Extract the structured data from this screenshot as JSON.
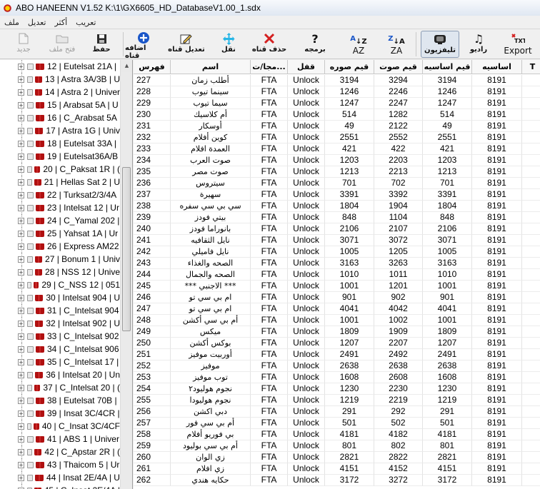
{
  "window": {
    "title": "ABO HANEENN    V1.52 K:\\1\\GX6605_HD_DatabaseV1.00_1.sdx"
  },
  "menu": [
    "ملف",
    "تعديل",
    "أكثر",
    "تعريب"
  ],
  "toolbar": {
    "new": "جديد",
    "open": "فتح ملف",
    "save": "حفظ",
    "add_channel": "اضافه قناه",
    "edit_channel": "تعديل قناه",
    "move": "نقل",
    "delete": "حذف قناه",
    "program": "برمجه",
    "sort_az": "AZ",
    "sort_za": "ZA",
    "tv": "تليفزيون",
    "radio": "راديو",
    "export": "Export"
  },
  "tree": {
    "items": [
      "12 | Eutelsat 21A |",
      "13 | Astra 3A/3B | U",
      "14 | Astra 2 | Univer",
      "15 | Arabsat 5A | U",
      "16 | C_Arabsat 5A",
      "17 | Astra 1G | Univ",
      "18 | Eutelsat 33A |",
      "19 | Eutelsat36A/B",
      "20 | C_Paksat 1R | (",
      "21 | Hellas Sat 2 | U",
      "22 | Turksat2/3/4A",
      "23 | Intelsat 12 | Ur",
      "24 | C_Yamal 202 |",
      "25 | Yahsat 1A | Ur",
      "26 | Express AM22",
      "27 | Bonum 1 | Univ",
      "28 | NSS 12 | Unive",
      "29 | C_NSS 12 | 051",
      "30 | Intelsat 904 | U",
      "31 | C_Intelsat 904",
      "32 | Intelsat 902 | U",
      "33 | C_Intelsat 902",
      "34 | C_Intelsat 906",
      "35 | C_Intelsat 17 |",
      "36 | Intelsat 20 | Un",
      "37 | C_Intelsat 20 | (",
      "38 | Eutelsat 70B |",
      "39 | Insat 3C/4CR |",
      "40 | C_Insat 3C/4CF",
      "41 | ABS 1 | Univer",
      "42 | C_Apstar 2R | (",
      "43 | Thaicom 5 | Ur",
      "44 | Insat 2E/4A | U",
      "45 | C_Insat 2E/4A |"
    ]
  },
  "grid": {
    "headers": [
      "فهرس",
      "اسم",
      "مجا/ت...",
      "قفل",
      "قيم صوره",
      "قيم صوت",
      "قيم اساسيه",
      "اساسيه",
      "T"
    ],
    "rows": [
      [
        "227",
        "أطلب زمان",
        "FTA",
        "Unlock",
        "3194",
        "3294",
        "3194",
        "8191"
      ],
      [
        "228",
        "سينما تيوب",
        "FTA",
        "Unlock",
        "1246",
        "2246",
        "1246",
        "8191"
      ],
      [
        "229",
        "سيما تيوب",
        "FTA",
        "Unlock",
        "1247",
        "2247",
        "1247",
        "8191"
      ],
      [
        "230",
        "أم كلاسيك",
        "FTA",
        "Unlock",
        "514",
        "1282",
        "514",
        "8191"
      ],
      [
        "231",
        "أوسكار",
        "FTA",
        "Unlock",
        "49",
        "2122",
        "49",
        "8191"
      ],
      [
        "232",
        "كوين أفلام",
        "FTA",
        "Unlock",
        "2551",
        "2552",
        "2551",
        "8191"
      ],
      [
        "233",
        "العمدة افلام",
        "FTA",
        "Unlock",
        "421",
        "422",
        "421",
        "8191"
      ],
      [
        "234",
        "صوت العرب",
        "FTA",
        "Unlock",
        "1203",
        "2203",
        "1203",
        "8191"
      ],
      [
        "235",
        "صوت مصر",
        "FTA",
        "Unlock",
        "1213",
        "2213",
        "1213",
        "8191"
      ],
      [
        "236",
        "سيتروس",
        "FTA",
        "Unlock",
        "701",
        "702",
        "701",
        "8191"
      ],
      [
        "237",
        "سهيرة",
        "FTA",
        "Unlock",
        "3391",
        "3392",
        "3391",
        "8191"
      ],
      [
        "238",
        "سي بي سي سفره",
        "FTA",
        "Unlock",
        "1804",
        "1904",
        "1804",
        "8191"
      ],
      [
        "239",
        "بيتي فودز",
        "FTA",
        "Unlock",
        "848",
        "1104",
        "848",
        "8191"
      ],
      [
        "240",
        "بانوراما فودز",
        "FTA",
        "Unlock",
        "2106",
        "2107",
        "2106",
        "8191"
      ],
      [
        "241",
        "نايل الثقافيه",
        "FTA",
        "Unlock",
        "3071",
        "3072",
        "3071",
        "8191"
      ],
      [
        "242",
        "نايل فاميلي",
        "FTA",
        "Unlock",
        "1005",
        "1205",
        "1005",
        "8191"
      ],
      [
        "243",
        "الصحه والغذاء",
        "FTA",
        "Unlock",
        "3163",
        "3263",
        "3163",
        "8191"
      ],
      [
        "244",
        "الصحه والجمال",
        "FTA",
        "Unlock",
        "1010",
        "1011",
        "1010",
        "8191"
      ],
      [
        "245",
        "*** الاجنبي ***",
        "FTA",
        "Unlock",
        "1001",
        "1201",
        "1001",
        "8191"
      ],
      [
        "246",
        "ام بي سي تو",
        "FTA",
        "Unlock",
        "901",
        "902",
        "901",
        "8191"
      ],
      [
        "247",
        "ام بي سي تو",
        "FTA",
        "Unlock",
        "4041",
        "4042",
        "4041",
        "8191"
      ],
      [
        "248",
        "أم بي سي أكشن",
        "FTA",
        "Unlock",
        "1001",
        "1002",
        "1001",
        "8191"
      ],
      [
        "249",
        "ميكس",
        "FTA",
        "Unlock",
        "1809",
        "1909",
        "1809",
        "8191"
      ],
      [
        "250",
        "بوكس أكشن",
        "FTA",
        "Unlock",
        "1207",
        "2207",
        "1207",
        "8191"
      ],
      [
        "251",
        "أوربيت موفيز",
        "FTA",
        "Unlock",
        "2491",
        "2492",
        "2491",
        "8191"
      ],
      [
        "252",
        "موفيز",
        "FTA",
        "Unlock",
        "2638",
        "2638",
        "2638",
        "8191"
      ],
      [
        "253",
        "توب موفيز",
        "FTA",
        "Unlock",
        "1608",
        "2608",
        "1608",
        "8191"
      ],
      [
        "254",
        "نجوم هوليود٢",
        "FTA",
        "Unlock",
        "1230",
        "2230",
        "1230",
        "8191"
      ],
      [
        "255",
        "نجوم هوليودا",
        "FTA",
        "Unlock",
        "1219",
        "2219",
        "1219",
        "8191"
      ],
      [
        "256",
        "دبي اكشن",
        "FTA",
        "Unlock",
        "291",
        "292",
        "291",
        "8191"
      ],
      [
        "257",
        "أم بي سي فور",
        "FTA",
        "Unlock",
        "501",
        "502",
        "501",
        "8191"
      ],
      [
        "258",
        "بي فوريو أفلام",
        "FTA",
        "Unlock",
        "4181",
        "4182",
        "4181",
        "8191"
      ],
      [
        "259",
        "أم بي سي بوليود",
        "FTA",
        "Unlock",
        "801",
        "802",
        "801",
        "8191"
      ],
      [
        "260",
        "زي الوان",
        "FTA",
        "Unlock",
        "2821",
        "2822",
        "2821",
        "8191"
      ],
      [
        "261",
        "زي افلام",
        "FTA",
        "Unlock",
        "4151",
        "4152",
        "4151",
        "8191"
      ],
      [
        "262",
        "حكايه هندي",
        "FTA",
        "Unlock",
        "3172",
        "3272",
        "3172",
        "8191"
      ]
    ]
  },
  "colors": {
    "accent": "#8a9bb3",
    "tree_icon": "#b01010",
    "add_icon": "#1a56c8"
  }
}
